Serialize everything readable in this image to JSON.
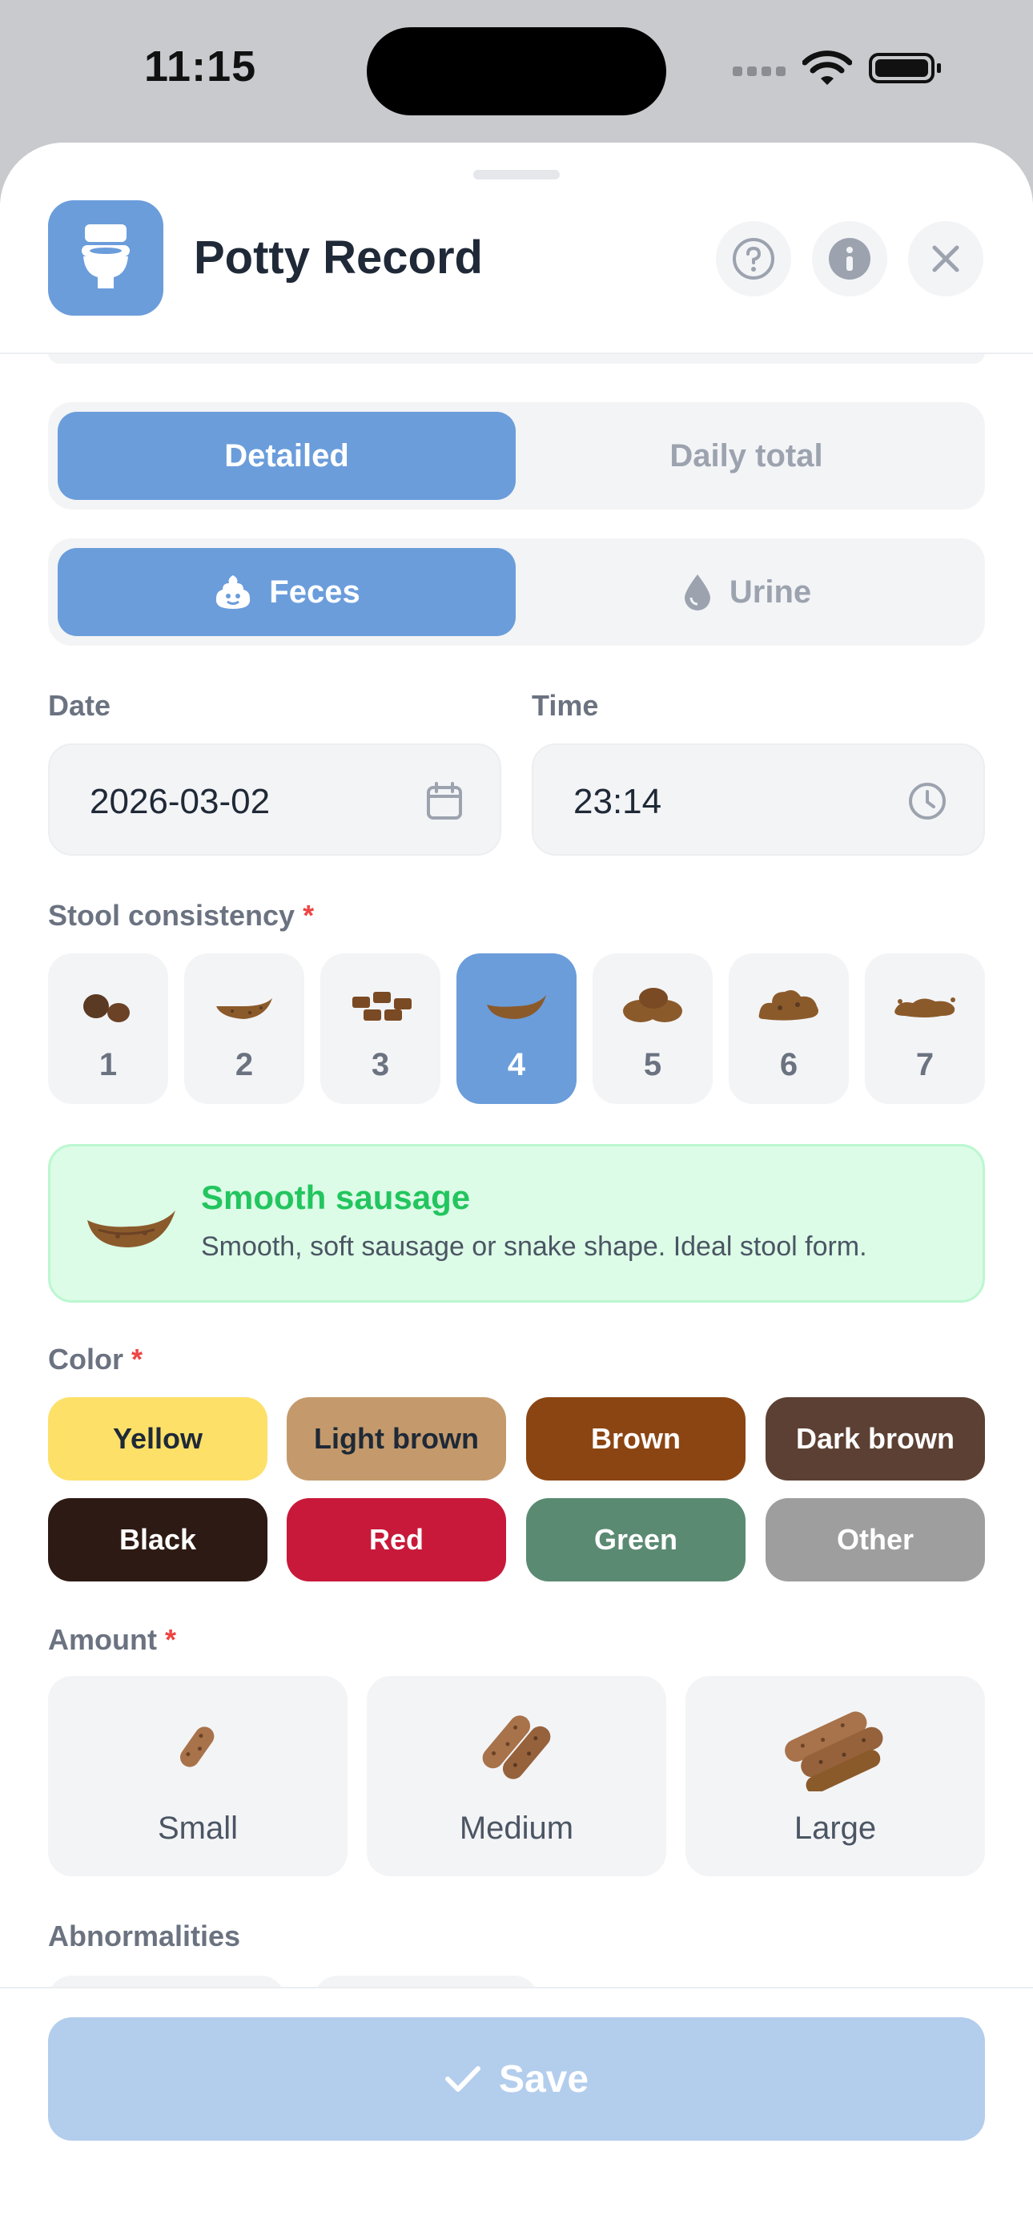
{
  "status_bar": {
    "time": "11:15"
  },
  "header": {
    "title": "Potty Record",
    "icons": [
      "toilet-icon",
      "help-icon",
      "info-icon",
      "close-icon"
    ]
  },
  "record_mode": {
    "options": [
      "Detailed",
      "Daily total"
    ],
    "selected": "Detailed"
  },
  "record_type": {
    "options": [
      "Feces",
      "Urine"
    ],
    "selected": "Feces"
  },
  "date": {
    "label": "Date",
    "value": "2026-03-02"
  },
  "time_field": {
    "label": "Time",
    "value": "23:14"
  },
  "stool_consistency": {
    "label": "Stool consistency",
    "required_mark": "*",
    "options": [
      "1",
      "2",
      "3",
      "4",
      "5",
      "6",
      "7"
    ],
    "selected": "4",
    "description": {
      "title": "Smooth sausage",
      "text": "Smooth, soft sausage or snake shape. Ideal stool form."
    }
  },
  "color": {
    "label": "Color",
    "required_mark": "*",
    "options": [
      {
        "label": "Yellow",
        "bg": "#fde068",
        "fg": "#1f2937"
      },
      {
        "label": "Light brown",
        "bg": "#c49a6c",
        "fg": "#1f2937"
      },
      {
        "label": "Brown",
        "bg": "#8b4513",
        "fg": "#ffffff"
      },
      {
        "label": "Dark brown",
        "bg": "#5c4033",
        "fg": "#ffffff"
      },
      {
        "label": "Black",
        "bg": "#2e1a14",
        "fg": "#ffffff"
      },
      {
        "label": "Red",
        "bg": "#c8193a",
        "fg": "#ffffff"
      },
      {
        "label": "Green",
        "bg": "#5b8a72",
        "fg": "#ffffff"
      },
      {
        "label": "Other",
        "bg": "#9e9e9e",
        "fg": "#ffffff"
      }
    ]
  },
  "amount": {
    "label": "Amount",
    "required_mark": "*",
    "options": [
      "Small",
      "Medium",
      "Large"
    ]
  },
  "abnormalities": {
    "label": "Abnormalities"
  },
  "footer": {
    "save_label": "Save"
  },
  "colors": {
    "accent": "#6b9ddb",
    "save_disabled": "#b3cdec",
    "required": "#ef4444",
    "success": "#22c55e"
  }
}
